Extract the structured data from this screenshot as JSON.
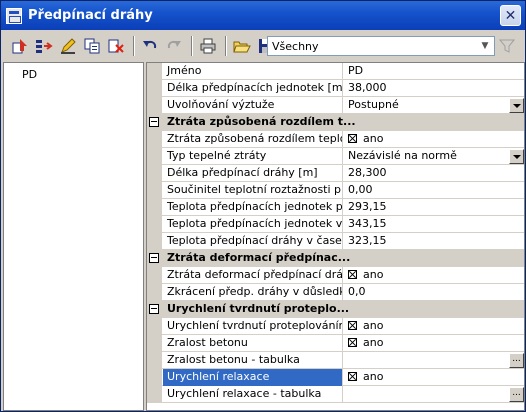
{
  "window": {
    "title": "Předpínací dráhy"
  },
  "toolbar": {
    "filter_value": "Všechny"
  },
  "tree": {
    "items": [
      "PD"
    ]
  },
  "grid": {
    "rows": [
      {
        "kind": "prop",
        "name": "Jméno",
        "value": "PD"
      },
      {
        "kind": "prop",
        "name": "Délka předpínacích jednotek [m]",
        "value": "38,000"
      },
      {
        "kind": "prop",
        "name": "Uvolňování výztuže",
        "value": "Postupné",
        "control": "dropdown"
      },
      {
        "kind": "cat",
        "name": "Ztráta způsobená rozdílem t..."
      },
      {
        "kind": "prop",
        "name": "Ztráta způsobená rozdílem teplot ...",
        "value": "ano",
        "control": "checkbox"
      },
      {
        "kind": "prop",
        "name": "Typ tepelné ztráty",
        "value": "Nezávislé na normě",
        "control": "dropdown"
      },
      {
        "kind": "prop",
        "name": "Délka předpínací dráhy [m]",
        "value": "28,300"
      },
      {
        "kind": "prop",
        "name": "Součinitel teplotní roztažnosti pře...",
        "value": "0,00"
      },
      {
        "kind": "prop",
        "name": "Teplota předpínacích jednotek p...",
        "value": "293,15"
      },
      {
        "kind": "prop",
        "name": "Teplota předpínacích jednotek v ...",
        "value": "343,15"
      },
      {
        "kind": "prop",
        "name": "Teplota předpínací dráhy v čase ...",
        "value": "323,15"
      },
      {
        "kind": "cat",
        "name": "Ztráta deformací předpínac..."
      },
      {
        "kind": "prop",
        "name": "Ztráta deformací předpínací dráhy",
        "value": "ano",
        "control": "checkbox"
      },
      {
        "kind": "prop",
        "name": "Zkrácení předp. dráhy v důsledku...",
        "value": "0,0"
      },
      {
        "kind": "cat",
        "name": "Urychlení tvrdnutí proteplo..."
      },
      {
        "kind": "prop",
        "name": "Urychlení tvrdnutí proteplováním ...",
        "value": "ano",
        "control": "checkbox"
      },
      {
        "kind": "prop",
        "name": "Zralost betonu",
        "value": "ano",
        "control": "checkbox"
      },
      {
        "kind": "prop",
        "name": "Zralost betonu - tabulka",
        "value": "",
        "control": "dots"
      },
      {
        "kind": "prop",
        "name": "Urychlení relaxace",
        "value": "ano",
        "control": "checkbox",
        "selected": true
      },
      {
        "kind": "prop",
        "name": "Urychlení relaxace - tabulka",
        "value": "",
        "control": "dots"
      }
    ]
  },
  "colors": {
    "selection": "#316ac5",
    "titlebar": "#1553cc"
  }
}
